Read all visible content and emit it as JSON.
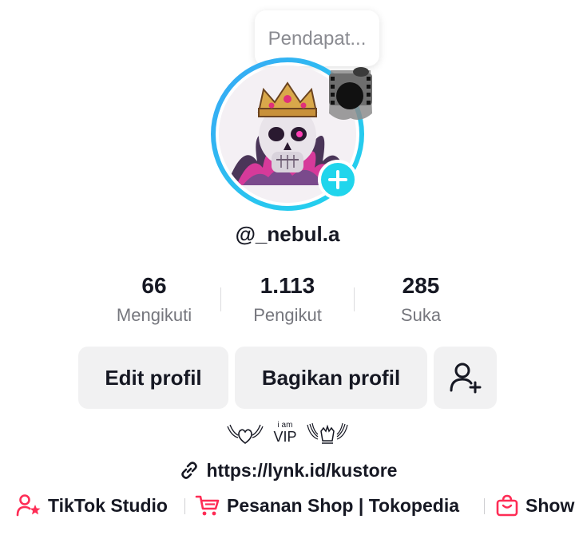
{
  "profile": {
    "thought_bubble": "Pendapat...",
    "username": "@_nebul.a"
  },
  "stats": [
    {
      "value": "66",
      "label": "Mengikuti"
    },
    {
      "value": "1.113",
      "label": "Pengikut"
    },
    {
      "value": "285",
      "label": "Suka"
    }
  ],
  "buttons": {
    "edit": "Edit profil",
    "share": "Bagikan profil"
  },
  "bio": {
    "vip_small": "i am",
    "vip_big": "VIP"
  },
  "link": {
    "url": "https://lynk.id/kustore"
  },
  "tools": [
    {
      "label": "TikTok Studio",
      "icon": "person-star-icon"
    },
    {
      "label": "Pesanan Shop | Tokopedia",
      "icon": "cart-icon"
    },
    {
      "label": "Show",
      "icon": "shop-bag-icon"
    }
  ],
  "colors": {
    "accent_cyan": "#20d5ec",
    "tiktok_pink": "#fe2c55",
    "text_primary": "#161823",
    "text_secondary": "#75767d",
    "button_bg": "#f1f1f2"
  }
}
